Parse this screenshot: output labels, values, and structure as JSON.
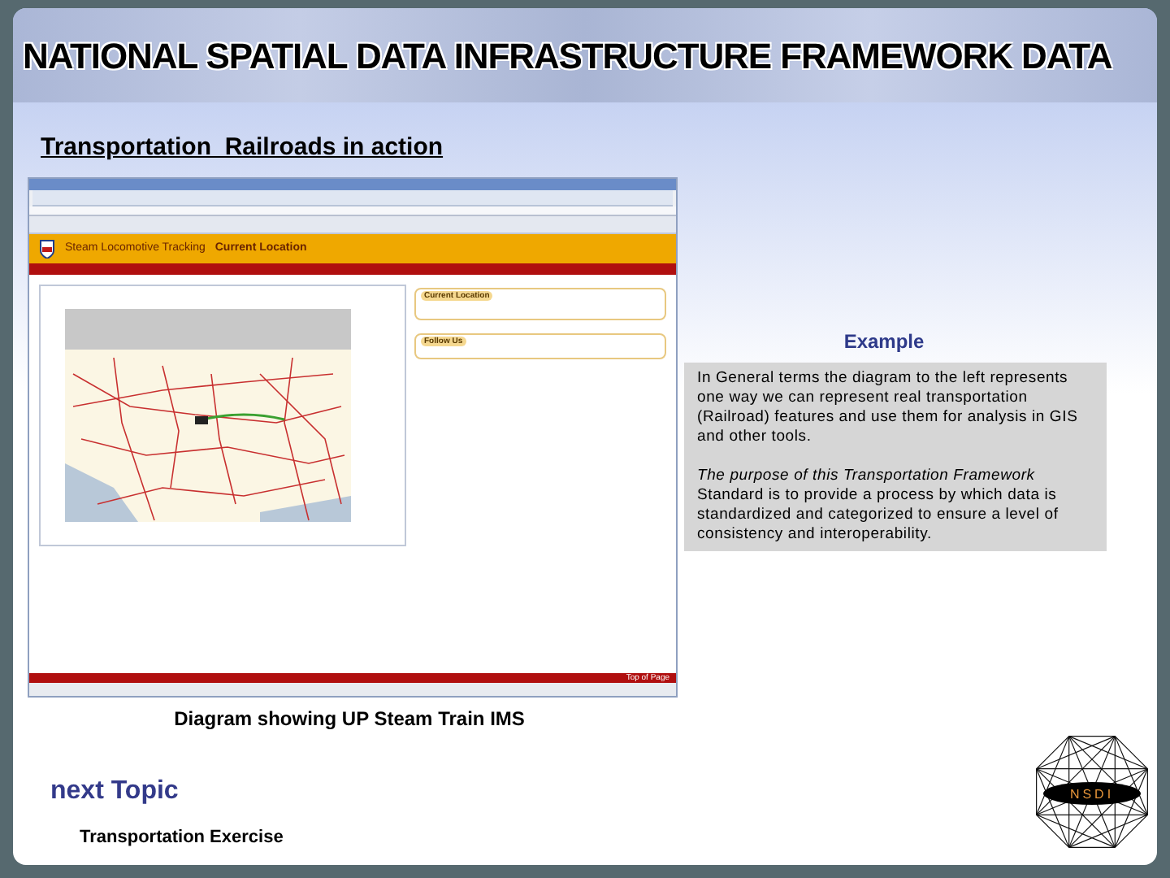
{
  "banner": {
    "title": "NATIONAL SPATIAL DATA INFRASTRUCTURE FRAMEWORK DATA"
  },
  "heading": "Transportation  Railroads in action",
  "screenshot": {
    "app_title": "Steam Locomotive Tracking",
    "page_title": "Current Location",
    "panels": [
      {
        "heading": "Current Location"
      },
      {
        "heading": "Follow Us"
      }
    ],
    "footer_link": "Top of Page"
  },
  "caption": "Diagram showing UP Steam Train IMS",
  "example": {
    "title": "Example",
    "paragraphs": [
      "In General terms the diagram to the left represents one way we can represent real transportation (Railroad) features and use them for analysis in GIS and other tools.",
      "*The purpose of this Transportation Framework* Standard is to provide a process by which data is standardized and categorized to ensure a level of consistency and interoperability."
    ]
  },
  "next_topic": {
    "title": "next Topic",
    "items": [
      "Transportation Exercise"
    ]
  },
  "logo": {
    "text": "NSDI"
  }
}
